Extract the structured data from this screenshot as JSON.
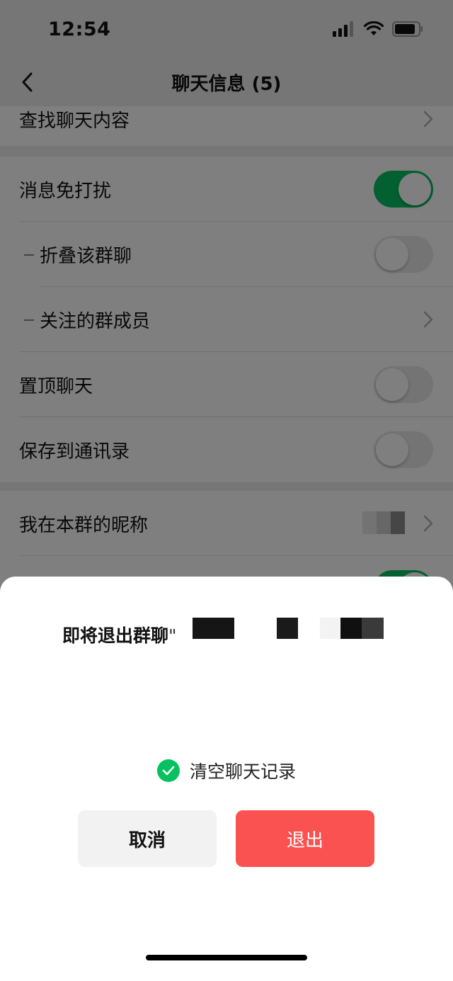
{
  "status": {
    "time": "12:54"
  },
  "nav": {
    "title": "聊天信息 (5)"
  },
  "search_row": {
    "label": "查找聊天内容"
  },
  "settings": {
    "mute": {
      "label": "消息免打扰",
      "on": true
    },
    "fold": {
      "label": "折叠该群聊",
      "on": false
    },
    "followed": {
      "label": "关注的群成员"
    },
    "pin": {
      "label": "置顶聊天",
      "on": false
    },
    "save_contacts": {
      "label": "保存到通讯录",
      "on": false
    }
  },
  "nickname_row": {
    "label": "我在本群的昵称"
  },
  "dialog": {
    "title_prefix": "即将退出群聊",
    "quote": "\"",
    "clear_history": {
      "label": "清空聊天记录",
      "checked": true
    },
    "cancel_label": "取消",
    "exit_label": "退出"
  },
  "colors": {
    "accent_green": "#07c160",
    "danger_red": "#fa5151"
  }
}
